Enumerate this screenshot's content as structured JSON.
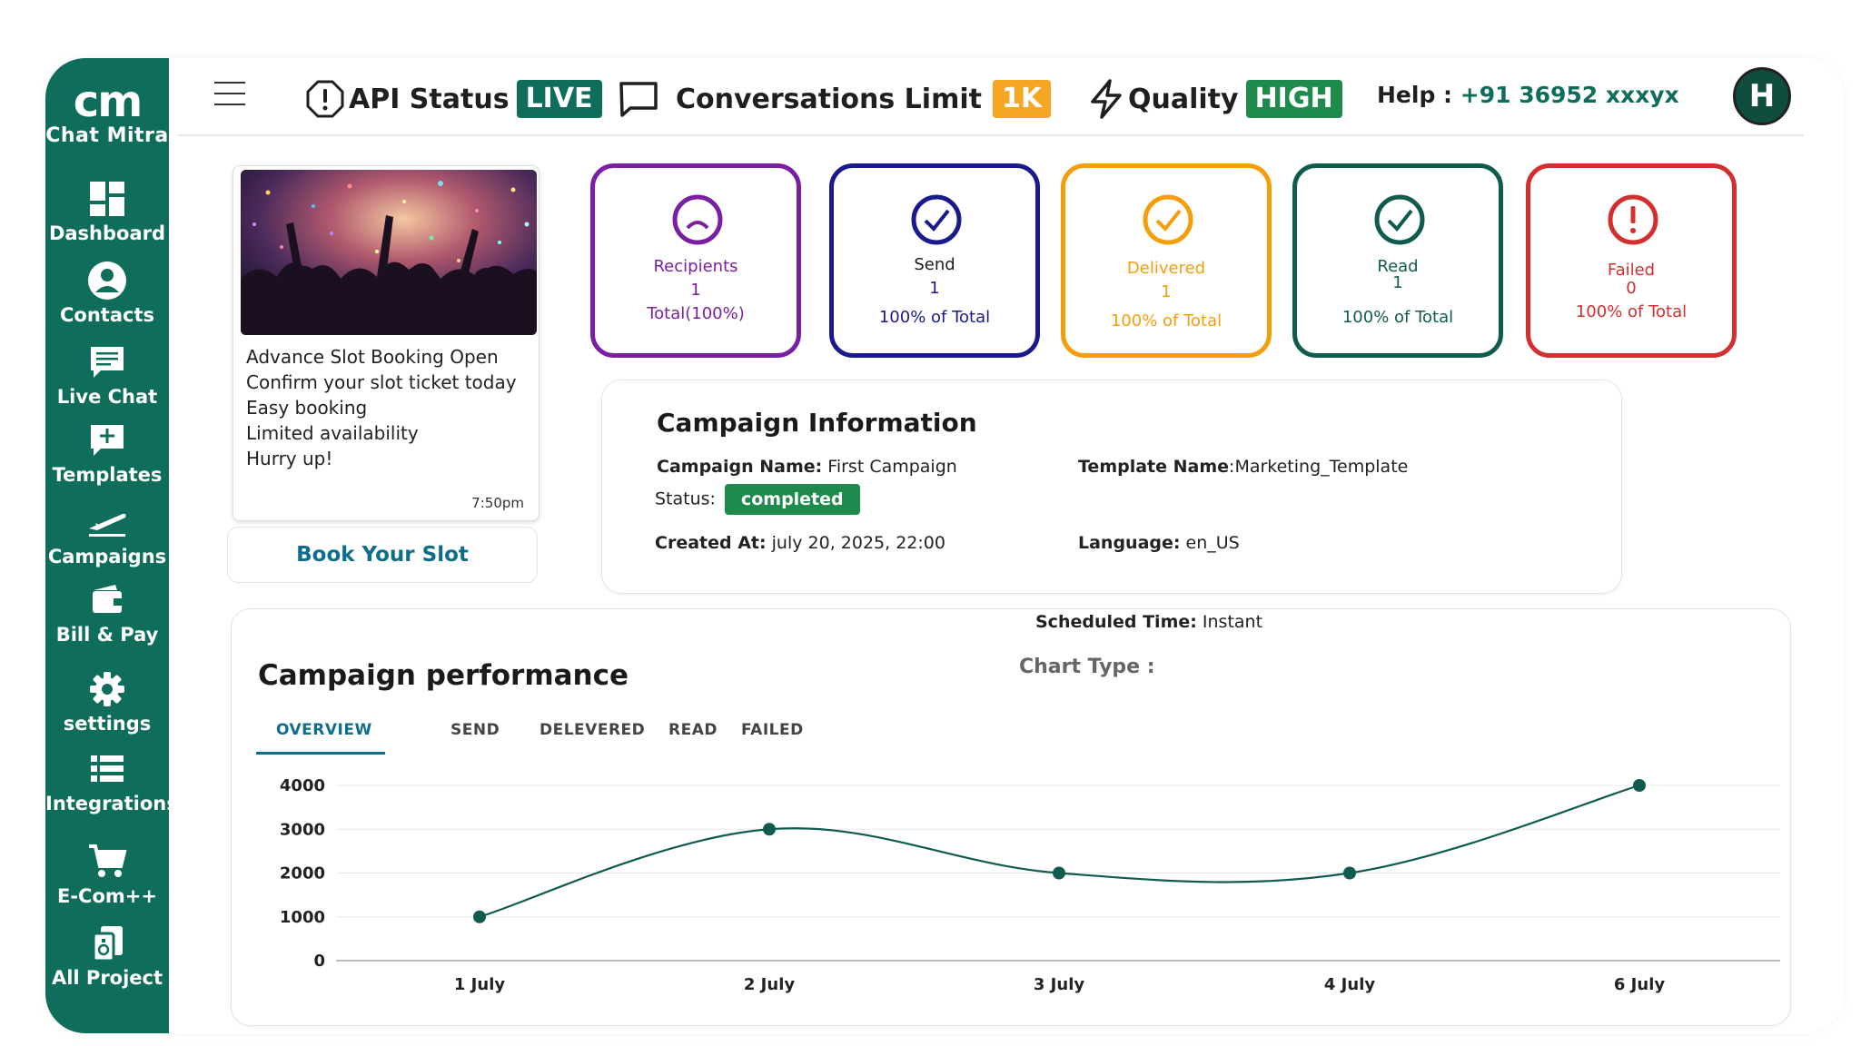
{
  "brand": {
    "mark": "cm",
    "name": "Chat Mitra"
  },
  "sidebar": {
    "items": [
      {
        "label": "Dashboard",
        "icon": "dashboard-icon"
      },
      {
        "label": "Contacts",
        "icon": "user-icon"
      },
      {
        "label": "Live Chat",
        "icon": "chat-icon"
      },
      {
        "label": "Templates",
        "icon": "template-icon"
      },
      {
        "label": "Campaigns",
        "icon": "plane-icon"
      },
      {
        "label": "Bill & Pay",
        "icon": "wallet-icon"
      },
      {
        "label": "settings",
        "icon": "gear-icon"
      },
      {
        "label": "Integrations",
        "icon": "list-icon"
      },
      {
        "label": "E-Com++",
        "icon": "cart-icon"
      },
      {
        "label": "All Project",
        "icon": "project-icon"
      }
    ]
  },
  "topbar": {
    "api_label": "API Status",
    "api_badge": "LIVE",
    "conv_label": "Conversations Limit",
    "conv_badge": "1K",
    "quality_label": "Quality",
    "quality_badge": "HIGH",
    "help_label": "Help :",
    "help_number": "+91 36952 xxxyx",
    "avatar_initial": "H"
  },
  "colors": {
    "brand": "#0f6d5c",
    "live_badge": "#0f6d5c",
    "limit_badge": "#f5a623",
    "quality_badge": "#1e8a4c",
    "recipients": "#7b1fa2",
    "send": "#1a1a8c",
    "delivered": "#f59e0b",
    "read": "#0f5c4f",
    "failed": "#d32f2f"
  },
  "message": {
    "lines": [
      "Advance Slot Booking Open",
      "Confirm your slot ticket today",
      " Easy booking",
      " Limited availability",
      " Hurry up!"
    ],
    "time": "7:50pm",
    "button": "Book Your Slot"
  },
  "stats": [
    {
      "title": "Recipients",
      "value": "1",
      "sub": "Total(100%)"
    },
    {
      "title": "Send",
      "value": "1",
      "sub": "100% of Total"
    },
    {
      "title": "Delivered",
      "value": "1",
      "sub": "100% of Total"
    },
    {
      "title": "Read",
      "value": "1",
      "sub": "100% of Total"
    },
    {
      "title": "Failed",
      "value": "0",
      "sub": "100% of Total"
    }
  ],
  "campaign": {
    "heading": "Campaign Information",
    "name_label": "Campaign Name:",
    "name": " First Campaign",
    "template_label": "Template Name",
    "template": ":Marketing_Template",
    "status_label": "Status:",
    "status": "completed",
    "created_label": "Created At:",
    "created": " july 20, 2025, 22:00",
    "language_label": "Language:",
    "language": " en_US",
    "scheduled_label": "Scheduled Time:",
    "scheduled": " Instant"
  },
  "performance": {
    "title": "Campaign performance",
    "chart_type_label": "Chart Type :",
    "tabs": [
      "OVERVIEW",
      "SEND",
      "DELEVERED",
      "READ",
      "FAILED"
    ],
    "active_tab": "OVERVIEW"
  },
  "chart_data": {
    "type": "line",
    "categories": [
      "1 July",
      "2 July",
      "3 July",
      "4 July",
      "6 July"
    ],
    "values": [
      1000,
      3000,
      2000,
      2000,
      4000
    ],
    "y_ticks": [
      "4000",
      "3000",
      "2000",
      "1000",
      "0"
    ],
    "ylim": [
      0,
      4000
    ],
    "grid": true,
    "color": "#0f5c4f"
  }
}
